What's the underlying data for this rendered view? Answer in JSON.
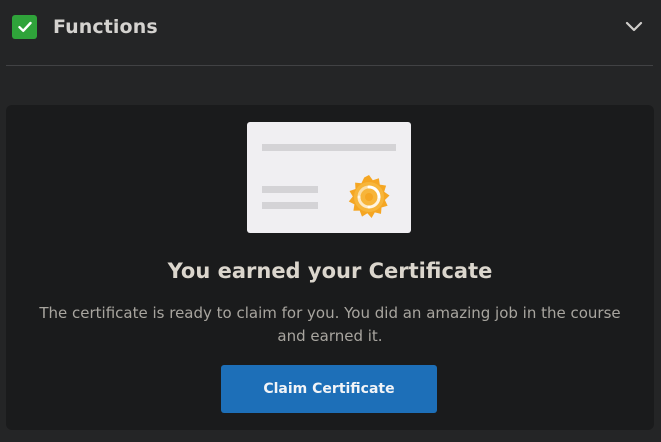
{
  "section": {
    "title": "Functions",
    "completed": true,
    "check_color": "#2fa33a",
    "expand_icon": "chevron-down-icon"
  },
  "certificate_card": {
    "illustration_icon": "certificate-icon",
    "seal_color": "#f5a623",
    "title": "You earned your Certificate",
    "description": "The certificate is ready to claim for you. You did an amazing job in the course and earned it.",
    "claim_button_label": "Claim Certificate",
    "button_color": "#1d6fb8"
  }
}
